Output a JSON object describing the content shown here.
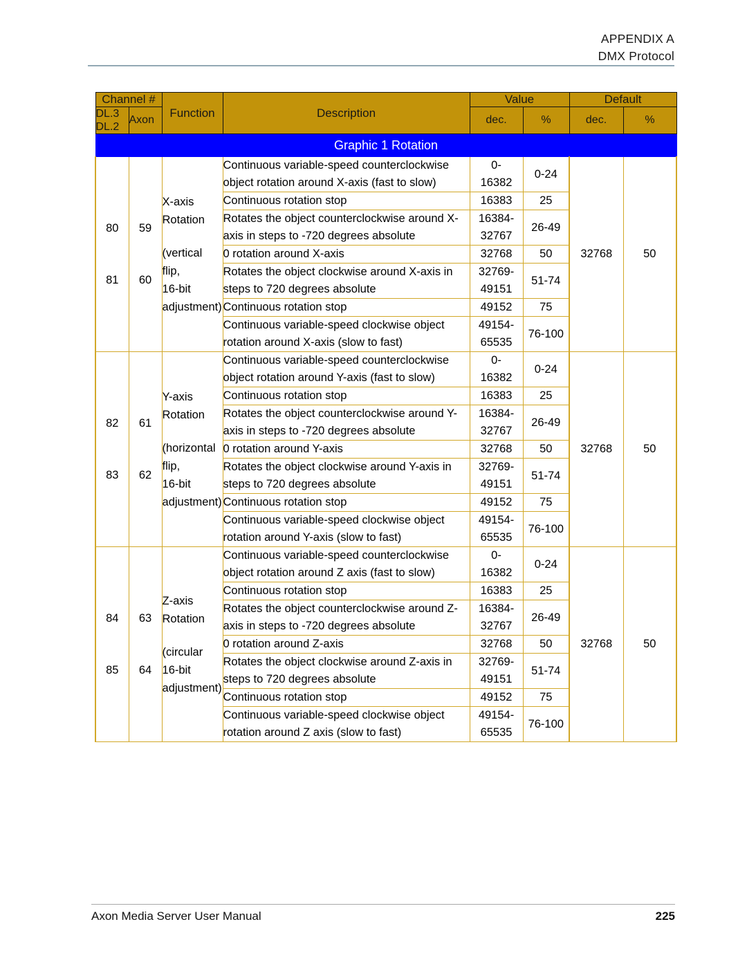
{
  "page": {
    "header_line1": "APPENDIX  A",
    "header_line2": "DMX Protocol",
    "footer_title": "Axon Media Server User Manual",
    "page_number": "225"
  },
  "colors": {
    "header_fill": "#C2930A",
    "section_band": "#0000FF",
    "border": "#D2A828",
    "header_rule": "#93A9B4"
  },
  "table": {
    "headers": {
      "channel": "Channel #",
      "dl": "DL.3\nDL.2",
      "dl_line1": "DL.3",
      "dl_line2": "DL.2",
      "axon": "Axon",
      "function": "Function",
      "description": "Description",
      "value": "Value",
      "default": "Default",
      "value_dec": "dec.",
      "value_pct": "%",
      "default_dec": "dec.",
      "default_pct": "%"
    },
    "section_title": "Graphic 1 Rotation",
    "blocks": [
      {
        "channel_dl_top": "80",
        "channel_axon_top": "59",
        "channel_dl_bottom": "81",
        "channel_axon_bottom": "60",
        "function_line1": "X-axis",
        "function_line2": "Rotation",
        "function_line3": "(vertical flip,",
        "function_line4": "16-bit",
        "function_line5": "adjustment)",
        "default_dec": "32768",
        "default_pct": "50",
        "rows": [
          {
            "description": "Continuous variable-speed counterclockwise object rotation around X-axis (fast to slow)",
            "dec": "0-\n16382",
            "dec_line1": "0-",
            "dec_line2": "16382",
            "pct": "0-24"
          },
          {
            "description": "Continuous rotation stop",
            "dec": "16383",
            "dec_line1": "16383",
            "dec_line2": "",
            "pct": "25"
          },
          {
            "description": "Rotates the object counterclockwise around X-axis in steps to -720 degrees absolute",
            "dec": "16384-\n32767",
            "dec_line1": "16384-",
            "dec_line2": "32767",
            "pct": "26-49"
          },
          {
            "description": "0  rotation around X-axis",
            "dec": "32768",
            "dec_line1": "32768",
            "dec_line2": "",
            "pct": "50"
          },
          {
            "description": "Rotates the object clockwise around X-axis in steps to 720 degrees absolute",
            "dec": "32769-\n49151",
            "dec_line1": "32769-",
            "dec_line2": "49151",
            "pct": "51-74"
          },
          {
            "description": "Continuous rotation stop",
            "dec": "49152",
            "dec_line1": "49152",
            "dec_line2": "",
            "pct": "75"
          },
          {
            "description": "Continuous variable-speed clockwise object rotation around X-axis (slow to fast)",
            "dec": "49154-\n65535",
            "dec_line1": "49154-",
            "dec_line2": "65535",
            "pct": "76-100"
          }
        ]
      },
      {
        "channel_dl_top": "82",
        "channel_axon_top": "61",
        "channel_dl_bottom": "83",
        "channel_axon_bottom": "62",
        "function_line1": "Y-axis",
        "function_line2": "Rotation",
        "function_line3": "(horizontal flip,",
        "function_line4": "16-bit",
        "function_line5": "adjustment)",
        "default_dec": "32768",
        "default_pct": "50",
        "rows": [
          {
            "description": "Continuous variable-speed counterclockwise object rotation around Y-axis (fast to slow)",
            "dec": "0-\n16382",
            "dec_line1": "0-",
            "dec_line2": "16382",
            "pct": "0-24"
          },
          {
            "description": "Continuous rotation stop",
            "dec": "16383",
            "dec_line1": "16383",
            "dec_line2": "",
            "pct": "25"
          },
          {
            "description": "Rotates the object counterclockwise around Y-axis in steps to -720 degrees absolute",
            "dec": "16384-\n32767",
            "dec_line1": "16384-",
            "dec_line2": "32767",
            "pct": "26-49"
          },
          {
            "description": "0  rotation around Y-axis",
            "dec": "32768",
            "dec_line1": "32768",
            "dec_line2": "",
            "pct": "50"
          },
          {
            "description": "Rotates the object clockwise around Y-axis in steps to 720 degrees absolute",
            "dec": "32769-\n49151",
            "dec_line1": "32769-",
            "dec_line2": "49151",
            "pct": "51-74"
          },
          {
            "description": "Continuous rotation stop",
            "dec": "49152",
            "dec_line1": "49152",
            "dec_line2": "",
            "pct": "75"
          },
          {
            "description": "Continuous variable-speed clockwise object rotation around Y-axis (slow to fast)",
            "dec": "49154-\n65535",
            "dec_line1": "49154-",
            "dec_line2": "65535",
            "pct": "76-100"
          }
        ]
      },
      {
        "channel_dl_top": "84",
        "channel_axon_top": "63",
        "channel_dl_bottom": "85",
        "channel_axon_bottom": "64",
        "function_line1": "Z-axis",
        "function_line2": "Rotation",
        "function_line3": "(circular 16-bit",
        "function_line4": "adjustment)",
        "function_line5": "",
        "default_dec": "32768",
        "default_pct": "50",
        "rows": [
          {
            "description": "Continuous variable-speed counterclockwise object rotation around Z axis (fast to slow)",
            "dec": "0-\n16382",
            "dec_line1": "0-",
            "dec_line2": "16382",
            "pct": "0-24"
          },
          {
            "description": "Continuous rotation stop",
            "dec": "16383",
            "dec_line1": "16383",
            "dec_line2": "",
            "pct": "25"
          },
          {
            "description": "Rotates the object counterclockwise around Z-axis in steps to -720 degrees absolute",
            "dec": "16384-\n32767",
            "dec_line1": "16384-",
            "dec_line2": "32767",
            "pct": "26-49"
          },
          {
            "description": "0  rotation around Z-axis",
            "dec": "32768",
            "dec_line1": "32768",
            "dec_line2": "",
            "pct": "50"
          },
          {
            "description": "Rotates the object clockwise around Z-axis in steps to 720 degrees absolute",
            "dec": "32769-\n49151",
            "dec_line1": "32769-",
            "dec_line2": "49151",
            "pct": "51-74"
          },
          {
            "description": "Continuous rotation stop",
            "dec": "49152",
            "dec_line1": "49152",
            "dec_line2": "",
            "pct": "75"
          },
          {
            "description": "Continuous variable-speed clockwise object rotation around Z axis (slow to fast)",
            "dec": "49154-\n65535",
            "dec_line1": "49154-",
            "dec_line2": "65535",
            "pct": "76-100"
          }
        ]
      }
    ]
  }
}
